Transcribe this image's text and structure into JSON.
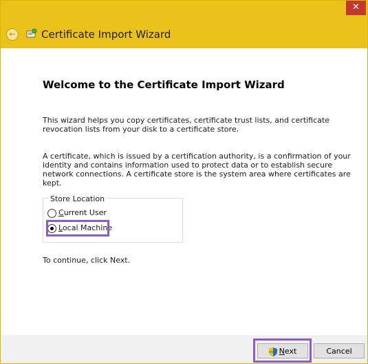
{
  "titlebar": {
    "close_label": "✕"
  },
  "header": {
    "title": "Certificate Import Wizard"
  },
  "content": {
    "welcome_title": "Welcome to the Certificate Import Wizard",
    "para1": "This wizard helps you copy certificates, certificate trust lists, and certificate revocation lists from your disk to a certificate store.",
    "para2": "A certificate, which is issued by a certification authority, is a confirmation of your identity and contains information used to protect data or to establish secure network connections. A certificate store is the system area where certificates are kept.",
    "store_location": {
      "legend": "Store Location",
      "options": [
        {
          "label_first": "C",
          "label_rest": "urrent User",
          "checked": false
        },
        {
          "label_first": "L",
          "label_rest": "ocal Machine",
          "checked": true
        }
      ]
    },
    "continue_text": "To continue, click Next."
  },
  "footer": {
    "next_first": "N",
    "next_rest": "ext",
    "cancel_label": "Cancel"
  },
  "colors": {
    "titlebar_bg": "#ebc11b",
    "highlight": "#8a5cc7",
    "close_bg": "#c0392b"
  }
}
